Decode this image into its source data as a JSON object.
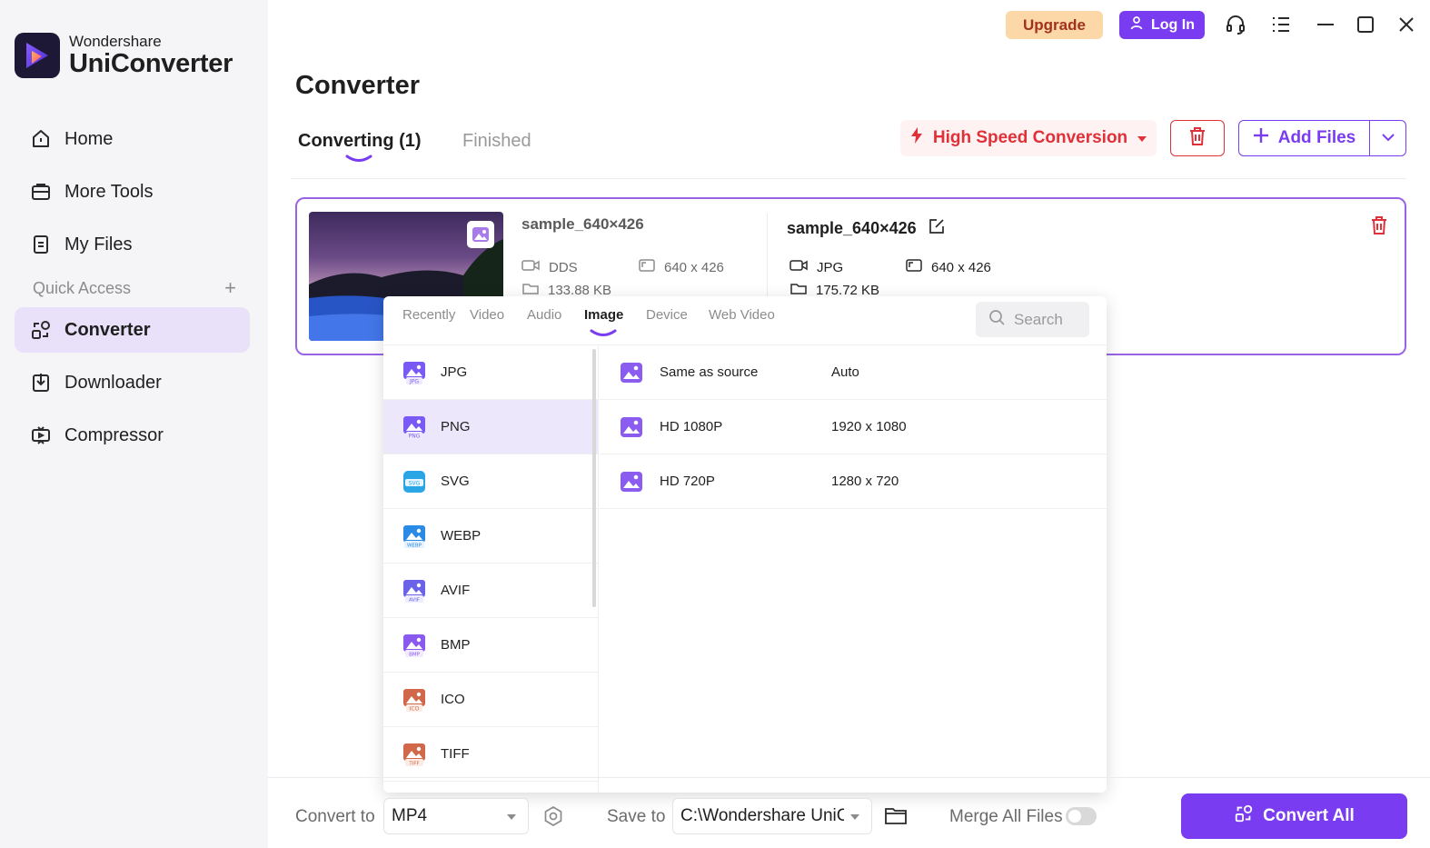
{
  "app": {
    "brand_small": "Wondershare",
    "brand_big": "UniConverter"
  },
  "titlebar": {
    "upgrade_label": "Upgrade",
    "login_label": "Log In"
  },
  "sidebar": {
    "items": [
      {
        "label": "Home",
        "icon": "home-icon"
      },
      {
        "label": "More Tools",
        "icon": "toolbox-icon"
      },
      {
        "label": "My Files",
        "icon": "file-icon"
      }
    ],
    "quick_access_label": "Quick Access",
    "quick_items": [
      {
        "label": "Converter",
        "icon": "converter-icon",
        "active": true
      },
      {
        "label": "Downloader",
        "icon": "downloader-icon"
      },
      {
        "label": "Compressor",
        "icon": "compressor-icon"
      }
    ]
  },
  "main": {
    "title": "Converter",
    "tabs": [
      {
        "label": "Converting (1)",
        "active": true
      },
      {
        "label": "Finished"
      }
    ],
    "high_speed_label": "High Speed Conversion",
    "add_files_label": "Add Files"
  },
  "file": {
    "source": {
      "name": "sample_640×426",
      "format": "DDS",
      "resolution": "640 x 426",
      "size": "133.88 KB"
    },
    "target": {
      "name": "sample_640×426",
      "format": "JPG",
      "resolution": "640 x 426",
      "size": "175.72 KB"
    }
  },
  "format_popup": {
    "tabs": [
      "Recently",
      "Video",
      "Audio",
      "Image",
      "Device",
      "Web Video"
    ],
    "active_tab": "Image",
    "search_placeholder": "Search",
    "formats": [
      {
        "label": "JPG",
        "badge": "JPG",
        "color": "#7a5af5"
      },
      {
        "label": "PNG",
        "badge": "PNG",
        "color": "#7a5af5",
        "selected": true
      },
      {
        "label": "SVG",
        "badge": "SVG",
        "color": "#2aa5e6"
      },
      {
        "label": "WEBP",
        "badge": "WEBP",
        "color": "#2a8be6"
      },
      {
        "label": "AVIF",
        "badge": "AVIF",
        "color": "#6a62e8"
      },
      {
        "label": "BMP",
        "badge": "BMP",
        "color": "#8a5af0"
      },
      {
        "label": "ICO",
        "badge": "ICO",
        "color": "#d2684a"
      },
      {
        "label": "TIFF",
        "badge": "TIFF",
        "color": "#d2684a"
      }
    ],
    "presets": [
      {
        "name": "Same as source",
        "value": "Auto"
      },
      {
        "name": "HD 1080P",
        "value": "1920 x 1080"
      },
      {
        "name": "HD 720P",
        "value": "1280 x 720"
      }
    ]
  },
  "bottom": {
    "convert_to_label": "Convert to",
    "convert_to_value": "MP4",
    "save_to_label": "Save to",
    "save_to_value": "C:\\Wondershare UniCo",
    "merge_label": "Merge All Files",
    "merge_enabled": false,
    "convert_all_label": "Convert All"
  },
  "colors": {
    "accent": "#7a3cf0",
    "danger": "#e0303a",
    "upgrade_bg": "#fcd8a8"
  }
}
